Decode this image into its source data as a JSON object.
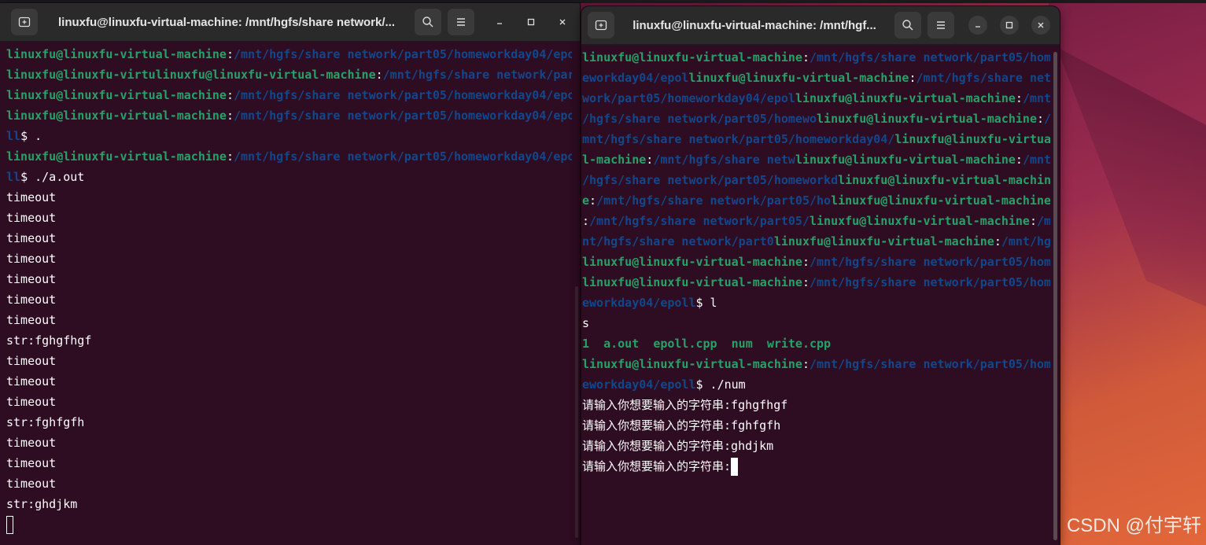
{
  "colors": {
    "terminal_bg": "#2e0c22",
    "user_green": "#26a269",
    "path_blue": "#12488b",
    "text_white": "#ffffff",
    "titlebar": "#2a2a2a"
  },
  "icons": {
    "new_tab": "new-tab-icon",
    "search": "search-icon",
    "menu": "hamburger-menu-icon",
    "minimize": "minimize-icon",
    "maximize": "maximize-icon",
    "close": "close-icon"
  },
  "left_window": {
    "title": "linuxfu@linuxfu-virtual-machine: /mnt/hgfs/share network/...",
    "lines": [
      [
        {
          "c": "u",
          "t": "linuxfu@linuxfu-virtual-machine"
        },
        {
          "c": "t",
          "t": ":"
        },
        {
          "c": "p",
          "t": "/mnt/hgfs/share network/part05/homeworkday04/epo"
        }
      ],
      [
        {
          "c": "u",
          "t": "linuxfu@linuxfu-virtulinuxfu@linuxfu-virtual-machine"
        },
        {
          "c": "t",
          "t": ":"
        },
        {
          "c": "p",
          "t": "/mnt/hgfs/share network/par"
        }
      ],
      [
        {
          "c": "u",
          "t": "linuxfu@linuxfu-virtual-machine"
        },
        {
          "c": "t",
          "t": ":"
        },
        {
          "c": "p",
          "t": "/mnt/hgfs/share network/part05/homeworkday04/epo"
        }
      ],
      [
        {
          "c": "u",
          "t": "linuxfu@linuxfu-virtual-machine"
        },
        {
          "c": "t",
          "t": ":"
        },
        {
          "c": "p",
          "t": "/mnt/hgfs/share network/part05/homeworkday04/epo"
        }
      ],
      [
        {
          "c": "p",
          "t": "ll"
        },
        {
          "c": "t",
          "t": "$ ."
        }
      ],
      [
        {
          "c": "u",
          "t": "linuxfu@linuxfu-virtual-machine"
        },
        {
          "c": "t",
          "t": ":"
        },
        {
          "c": "p",
          "t": "/mnt/hgfs/share network/part05/homeworkday04/epo"
        }
      ],
      [
        {
          "c": "p",
          "t": "ll"
        },
        {
          "c": "t",
          "t": "$ ./a.out"
        }
      ],
      [
        {
          "c": "t",
          "t": "timeout"
        }
      ],
      [
        {
          "c": "t",
          "t": "timeout"
        }
      ],
      [
        {
          "c": "t",
          "t": "timeout"
        }
      ],
      [
        {
          "c": "t",
          "t": "timeout"
        }
      ],
      [
        {
          "c": "t",
          "t": "timeout"
        }
      ],
      [
        {
          "c": "t",
          "t": "timeout"
        }
      ],
      [
        {
          "c": "t",
          "t": "timeout"
        }
      ],
      [
        {
          "c": "t",
          "t": "str:fghgfhgf"
        }
      ],
      [
        {
          "c": "t",
          "t": "timeout"
        }
      ],
      [
        {
          "c": "t",
          "t": "timeout"
        }
      ],
      [
        {
          "c": "t",
          "t": "timeout"
        }
      ],
      [
        {
          "c": "t",
          "t": "str:fghfgfh"
        }
      ],
      [
        {
          "c": "t",
          "t": "timeout"
        }
      ],
      [
        {
          "c": "t",
          "t": "timeout"
        }
      ],
      [
        {
          "c": "t",
          "t": "timeout"
        }
      ],
      [
        {
          "c": "t",
          "t": "str:ghdjkm"
        }
      ]
    ]
  },
  "right_window": {
    "title": "linuxfu@linuxfu-virtual-machine: /mnt/hgf...",
    "lines": [
      [
        {
          "c": "u",
          "t": "linuxfu@linuxfu-virtual-machine"
        },
        {
          "c": "t",
          "t": ":"
        },
        {
          "c": "p",
          "t": "/mnt/hgfs/share network/part05/hom"
        }
      ],
      [
        {
          "c": "p",
          "t": "eworkday04/epol"
        },
        {
          "c": "u",
          "t": "linuxfu@linuxfu-virtual-machine"
        },
        {
          "c": "t",
          "t": ":"
        },
        {
          "c": "p",
          "t": "/mnt/hgfs/share net"
        }
      ],
      [
        {
          "c": "p",
          "t": "work/part05/homeworkday04/epol"
        },
        {
          "c": "u",
          "t": "linuxfu@linuxfu-virtual-machine"
        },
        {
          "c": "t",
          "t": ":"
        },
        {
          "c": "p",
          "t": "/mnt"
        }
      ],
      [
        {
          "c": "p",
          "t": "/hgfs/share network/part05/homewo"
        },
        {
          "c": "u",
          "t": "linuxfu@linuxfu-virtual-machine"
        },
        {
          "c": "t",
          "t": ":"
        },
        {
          "c": "p",
          "t": "/"
        }
      ],
      [
        {
          "c": "p",
          "t": "mnt/hgfs/share network/part05/homeworkday04/"
        },
        {
          "c": "u",
          "t": "linuxfu@linuxfu-virtua"
        }
      ],
      [
        {
          "c": "u",
          "t": "l-machine"
        },
        {
          "c": "t",
          "t": ":"
        },
        {
          "c": "p",
          "t": "/mnt/hgfs/share netw"
        },
        {
          "c": "u",
          "t": "linuxfu@linuxfu-virtual-machine"
        },
        {
          "c": "t",
          "t": ":"
        },
        {
          "c": "p",
          "t": "/mnt"
        }
      ],
      [
        {
          "c": "p",
          "t": "/hgfs/share network/part05/homeworkd"
        },
        {
          "c": "u",
          "t": "linuxfu@linuxfu-virtual-machin"
        }
      ],
      [
        {
          "c": "u",
          "t": "e"
        },
        {
          "c": "t",
          "t": ":"
        },
        {
          "c": "p",
          "t": "/mnt/hgfs/share network/part05/ho"
        },
        {
          "c": "u",
          "t": "linuxfu@linuxfu-virtual-machine"
        }
      ],
      [
        {
          "c": "t",
          "t": ":"
        },
        {
          "c": "p",
          "t": "/mnt/hgfs/share network/part05/"
        },
        {
          "c": "u",
          "t": "linuxfu@linuxfu-virtual-machine"
        },
        {
          "c": "t",
          "t": ":"
        },
        {
          "c": "p",
          "t": "/m"
        }
      ],
      [
        {
          "c": "p",
          "t": "nt/hgfs/share network/part0"
        },
        {
          "c": "u",
          "t": "linuxfu@linuxfu-virtual-machine"
        },
        {
          "c": "t",
          "t": ":"
        },
        {
          "c": "p",
          "t": "/mnt/hg"
        }
      ],
      [
        {
          "c": "u",
          "t": "linuxfu@linuxfu-virtual-machine"
        },
        {
          "c": "t",
          "t": ":"
        },
        {
          "c": "p",
          "t": "/mnt/hgfs/share network/part05/hom"
        }
      ],
      [
        {
          "c": "u",
          "t": "linuxfu@linuxfu-virtual-machine"
        },
        {
          "c": "t",
          "t": ":"
        },
        {
          "c": "p",
          "t": "/mnt/hgfs/share network/part05/hom"
        }
      ],
      [
        {
          "c": "p",
          "t": "eworkday04/epoll"
        },
        {
          "c": "t",
          "t": "$ l"
        }
      ],
      [
        {
          "c": "t",
          "t": "s"
        }
      ],
      [
        {
          "c": "lsg",
          "t": "1"
        },
        {
          "c": "t",
          "t": "  "
        },
        {
          "c": "lsg",
          "t": "a.out"
        },
        {
          "c": "t",
          "t": "  "
        },
        {
          "c": "lsg",
          "t": "epoll.cpp"
        },
        {
          "c": "t",
          "t": "  "
        },
        {
          "c": "lsg",
          "t": "num"
        },
        {
          "c": "t",
          "t": "  "
        },
        {
          "c": "lsg",
          "t": "write.cpp"
        }
      ],
      [
        {
          "c": "u",
          "t": "linuxfu@linuxfu-virtual-machine"
        },
        {
          "c": "t",
          "t": ":"
        },
        {
          "c": "p",
          "t": "/mnt/hgfs/share network/part05/hom"
        }
      ],
      [
        {
          "c": "p",
          "t": "eworkday04/epoll"
        },
        {
          "c": "t",
          "t": "$ ./num"
        }
      ],
      [
        {
          "c": "t",
          "t": "请输入你想要输入的字符串:fghgfhgf"
        }
      ],
      [
        {
          "c": "t",
          "t": "请输入你想要输入的字符串:fghfgfh"
        }
      ],
      [
        {
          "c": "t",
          "t": "请输入你想要输入的字符串:ghdjkm"
        }
      ],
      [
        {
          "c": "t",
          "t": "请输入你想要输入的字符串:"
        }
      ]
    ]
  },
  "watermark": "CSDN @付宇轩"
}
